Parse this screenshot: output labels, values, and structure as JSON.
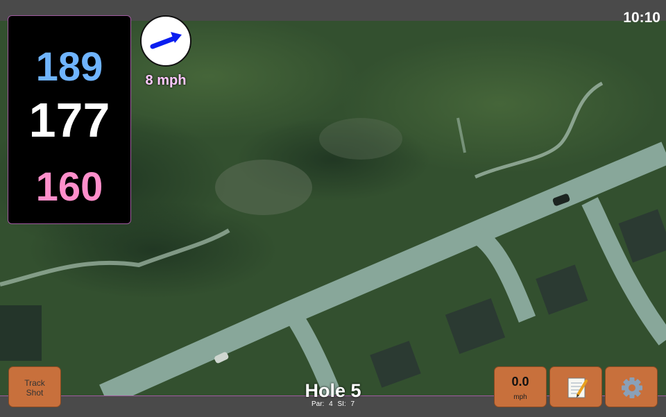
{
  "status": {
    "clock": "10:10"
  },
  "distances": {
    "back": "189",
    "middle": "177",
    "front": "160"
  },
  "wind": {
    "speed_label": "8 mph",
    "icon": "wind-direction-arrow-icon"
  },
  "hole": {
    "title": "Hole 5",
    "par_label": "Par: 4",
    "si_label": "SI: 7"
  },
  "buttons": {
    "track_shot_line1": "Track",
    "track_shot_line2": "Shot",
    "speed_value": "0.0",
    "speed_unit": "mph",
    "notes_icon": "notepad-icon",
    "settings_icon": "gear-icon"
  },
  "colors": {
    "back_distance": "#6fb4ff",
    "middle_distance": "#ffffff",
    "front_distance": "#ff8fcb",
    "button": "#c8703c",
    "bar_border": "#a05aa0"
  }
}
